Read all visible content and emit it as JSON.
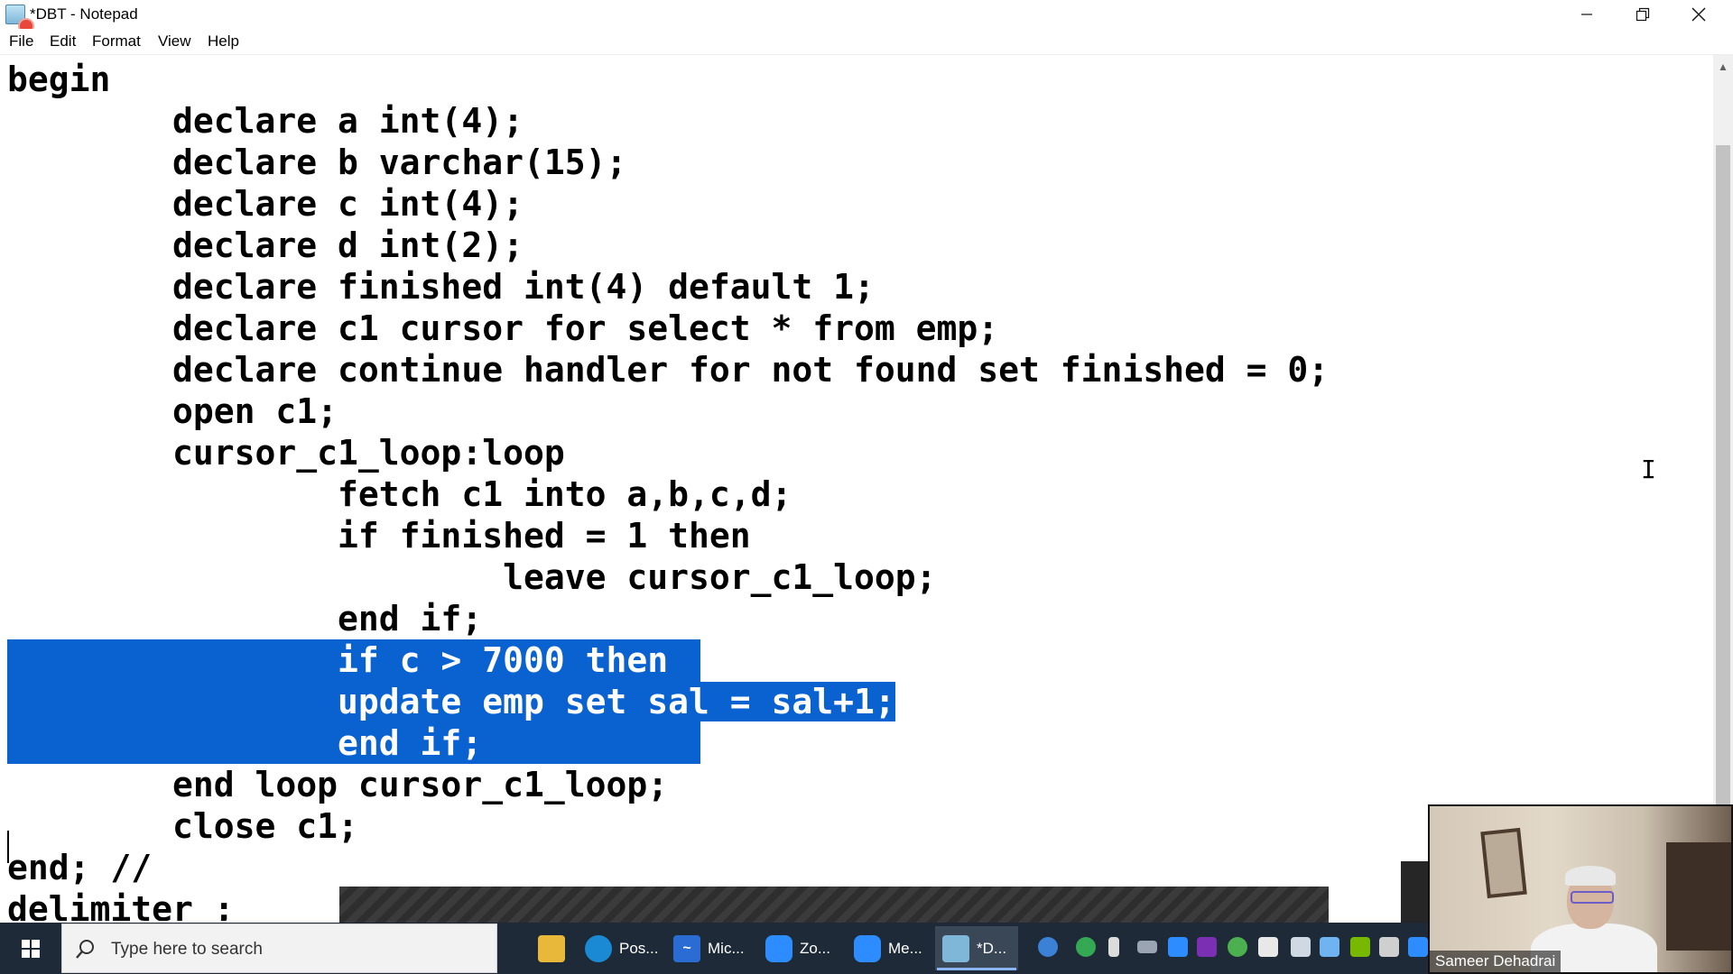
{
  "window": {
    "title": "*DBT - Notepad",
    "icon": "notepad-icon"
  },
  "menu": [
    "File",
    "Edit",
    "Format",
    "View",
    "Help"
  ],
  "editor": {
    "lines": [
      "begin",
      "        declare a int(4);",
      "        declare b varchar(15);",
      "        declare c int(4);",
      "        declare d int(2);",
      "        declare finished int(4) default 1;",
      "        declare c1 cursor for select * from emp;",
      "        declare continue handler for not found set finished = 0;",
      "        open c1;",
      "        cursor_c1_loop:loop",
      "                fetch c1 into a,b,c,d;",
      "                if finished = 1 then",
      "                        leave cursor_c1_loop;",
      "                end if;",
      "                if c > 7000 then",
      "                update emp set sal = sal+1;",
      "                end if;",
      "        end loop cursor_c1_loop;",
      "        close c1;",
      "end; //",
      "delimiter ;"
    ],
    "selected_lines": [
      14,
      15,
      16
    ],
    "selection_color": "#0a62d1"
  },
  "taskbar": {
    "search_placeholder": "Type here to search",
    "apps": [
      {
        "label": "",
        "icon": "file-explorer-icon",
        "color": "#e8b83a"
      },
      {
        "label": "Pos...",
        "icon": "edge-icon",
        "color": "#1a8ad4"
      },
      {
        "label": "Mic...",
        "icon": "whiteboard-icon",
        "color": "#2b6cd4"
      },
      {
        "label": "Zo...",
        "icon": "zoom-icon",
        "color": "#2d8cff"
      },
      {
        "label": "Me...",
        "icon": "zoom-meeting-icon",
        "color": "#2d8cff"
      },
      {
        "label": "*D...",
        "icon": "notepad-icon",
        "color": "#7fb7d8"
      }
    ]
  },
  "webcam": {
    "name": "Sameer Dehadrai"
  },
  "colors": {
    "taskbar": "#1f2a38",
    "selection": "#0a62d1"
  }
}
